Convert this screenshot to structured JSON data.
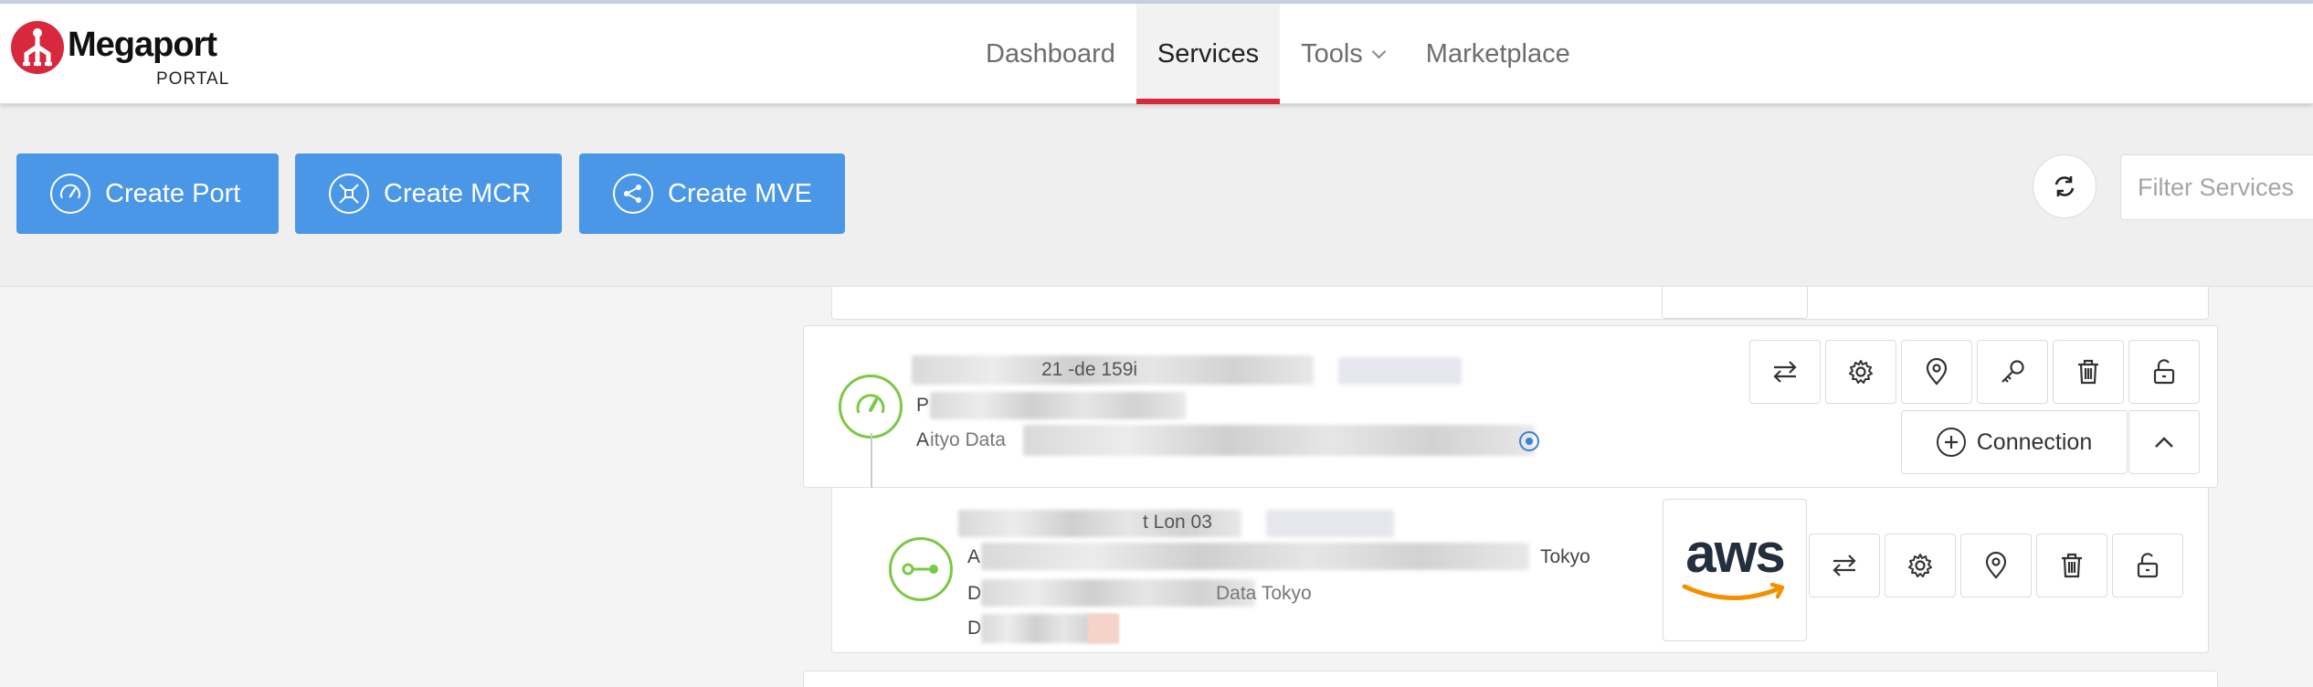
{
  "brand": {
    "name": "Megaport",
    "sub": "PORTAL",
    "color": "#d7283e"
  },
  "nav": [
    {
      "label": "Dashboard",
      "active": false
    },
    {
      "label": "Services",
      "active": true
    },
    {
      "label": "Tools",
      "active": false,
      "dropdown": true
    },
    {
      "label": "Marketplace",
      "active": false
    }
  ],
  "toolbar": {
    "create_port": "Create Port",
    "create_mcr": "Create MCR",
    "create_mve": "Create MVE",
    "filter_placeholder": "Filter Services",
    "accent": "#4a97e8"
  },
  "services": {
    "port": {
      "name_fragment": "21 -de 159i",
      "line2_prefix": "P",
      "line3_prefix": "A",
      "line3_fragment": "ityo Data",
      "status_color": "#7ac943",
      "actions": [
        "swap-icon",
        "gear-icon",
        "location-pin-icon",
        "key-icon",
        "trash-icon",
        "unlock-icon"
      ],
      "connection_label": "Connection"
    },
    "vxc": {
      "name_fragment": "t Lon 03",
      "line1_prefix": "A",
      "line1_suffix": "Tokyo",
      "line2_prefix": "D",
      "line2_fragment": "Data Tokyo",
      "line3_prefix": "D",
      "provider_logo": "aws",
      "actions": [
        "swap-icon",
        "gear-icon",
        "location-pin-icon",
        "trash-icon",
        "unlock-icon"
      ]
    }
  }
}
